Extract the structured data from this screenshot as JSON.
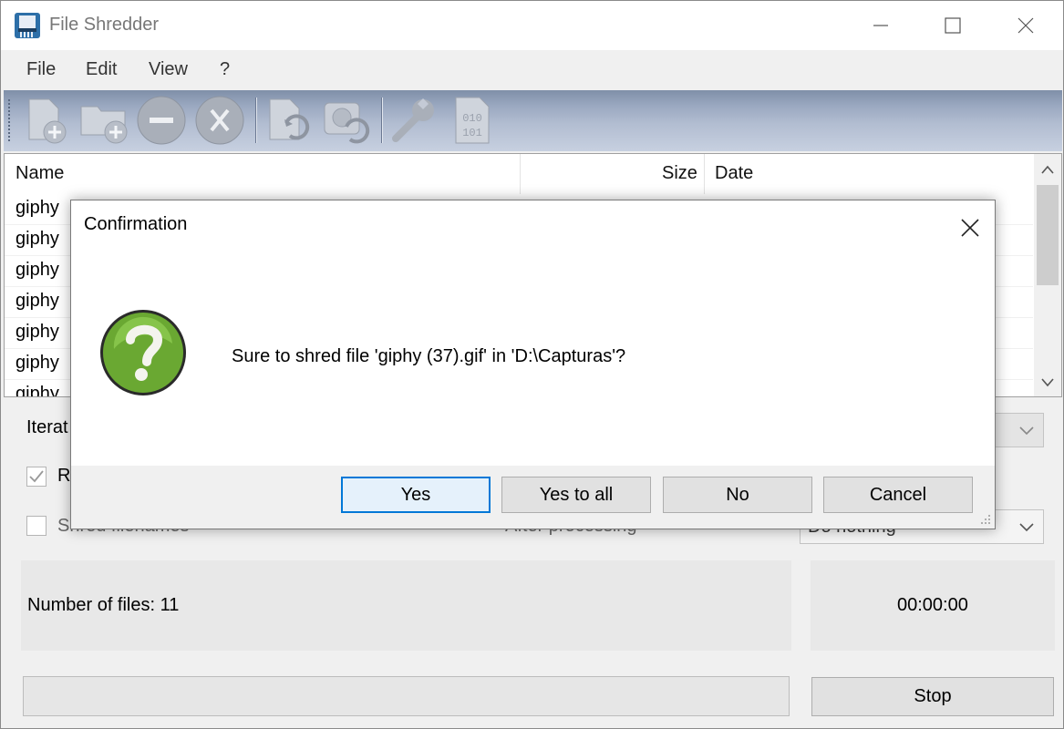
{
  "window": {
    "title": "File Shredder"
  },
  "menu": {
    "items": [
      "File",
      "Edit",
      "View",
      "?"
    ]
  },
  "toolbar": {
    "buttons": [
      "add-file-icon",
      "add-folder-icon",
      "remove-icon",
      "clear-icon",
      "shred-file-icon",
      "shred-drive-icon",
      "settings-wrench-icon",
      "binary-icon"
    ]
  },
  "filelist": {
    "columns": {
      "name": "Name",
      "size": "Size",
      "date": "Date"
    },
    "rows": [
      "giphy",
      "giphy",
      "giphy",
      "giphy",
      "giphy",
      "giphy",
      "giphy"
    ]
  },
  "settings": {
    "iterations_label": "Iterat",
    "checkbox1_label": "R",
    "checkbox1_checked": true,
    "checkbox2_label": "Shred filenames",
    "checkbox2_checked": false,
    "after_label": "After processing",
    "after_value": "Do nothing"
  },
  "status": {
    "files_count": "Number of files: 11",
    "elapsed": "00:00:00"
  },
  "footer": {
    "stop_label": "Stop"
  },
  "dialog": {
    "title": "Confirmation",
    "message": "Sure to shred file 'giphy (37).gif' in 'D:\\Capturas'?",
    "buttons": {
      "yes": "Yes",
      "yes_all": "Yes to all",
      "no": "No",
      "cancel": "Cancel"
    }
  }
}
